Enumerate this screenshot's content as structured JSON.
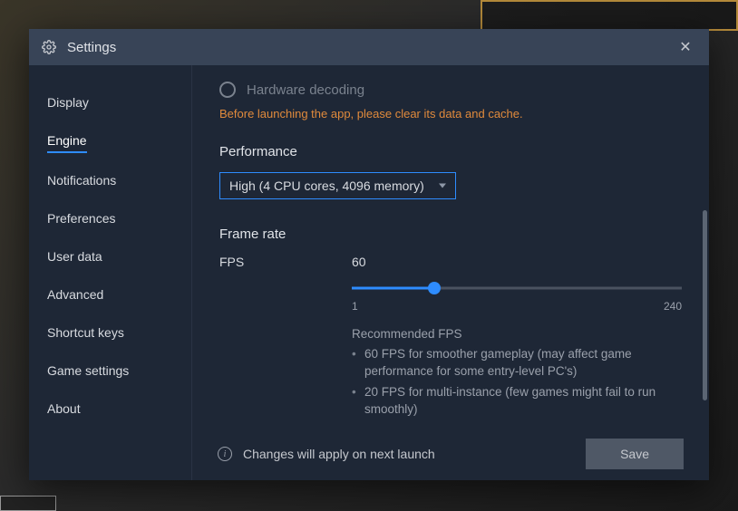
{
  "titlebar": {
    "title": "Settings"
  },
  "sidebar": {
    "items": [
      {
        "label": "Display",
        "active": false
      },
      {
        "label": "Engine",
        "active": true
      },
      {
        "label": "Notifications",
        "active": false
      },
      {
        "label": "Preferences",
        "active": false
      },
      {
        "label": "User data",
        "active": false
      },
      {
        "label": "Advanced",
        "active": false
      },
      {
        "label": "Shortcut keys",
        "active": false
      },
      {
        "label": "Game settings",
        "active": false
      },
      {
        "label": "About",
        "active": false
      }
    ]
  },
  "settings": {
    "hardware_decoding_label": "Hardware decoding",
    "warning": "Before launching the app, please clear its data and cache.",
    "performance_title": "Performance",
    "performance_value": "High (4 CPU cores, 4096 memory)",
    "frame_rate_title": "Frame rate",
    "fps_label": "FPS",
    "fps_value": "60",
    "fps_min": "1",
    "fps_max": "240",
    "rec_title": "Recommended FPS",
    "rec_items": [
      "60 FPS for smoother gameplay (may affect game performance for some entry-level PC's)",
      "20 FPS for multi-instance (few games might fail to run smoothly)"
    ]
  },
  "footer": {
    "notice": "Changes will apply on next launch",
    "save_label": "Save"
  }
}
